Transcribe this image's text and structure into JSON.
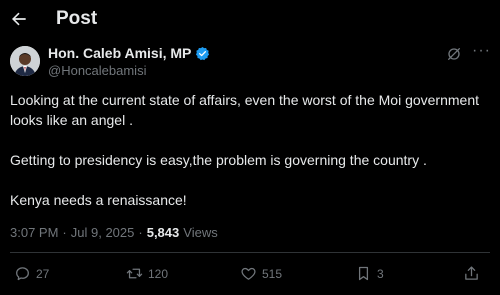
{
  "header": {
    "title": "Post"
  },
  "author": {
    "name": "Hon. Caleb Amisi, MP",
    "handle": "@Honcalebamisi"
  },
  "tweet": {
    "paragraphs": [
      "Looking at the current state of affairs, even the worst of the Moi government looks like an angel .",
      "Getting to presidency is easy,the problem is governing the country .",
      "Kenya needs a renaissance!"
    ]
  },
  "meta": {
    "time": "3:07 PM",
    "separator": "·",
    "date": "Jul 9, 2025",
    "views_count": "5,843",
    "views_label": "Views"
  },
  "actions": {
    "replies": "27",
    "reposts": "120",
    "likes": "515",
    "bookmarks": "3"
  },
  "colors": {
    "background": "#000000",
    "text": "#e7e9ea",
    "muted": "#71767b",
    "verified": "#1d9bf0",
    "divider": "#2f3336"
  }
}
